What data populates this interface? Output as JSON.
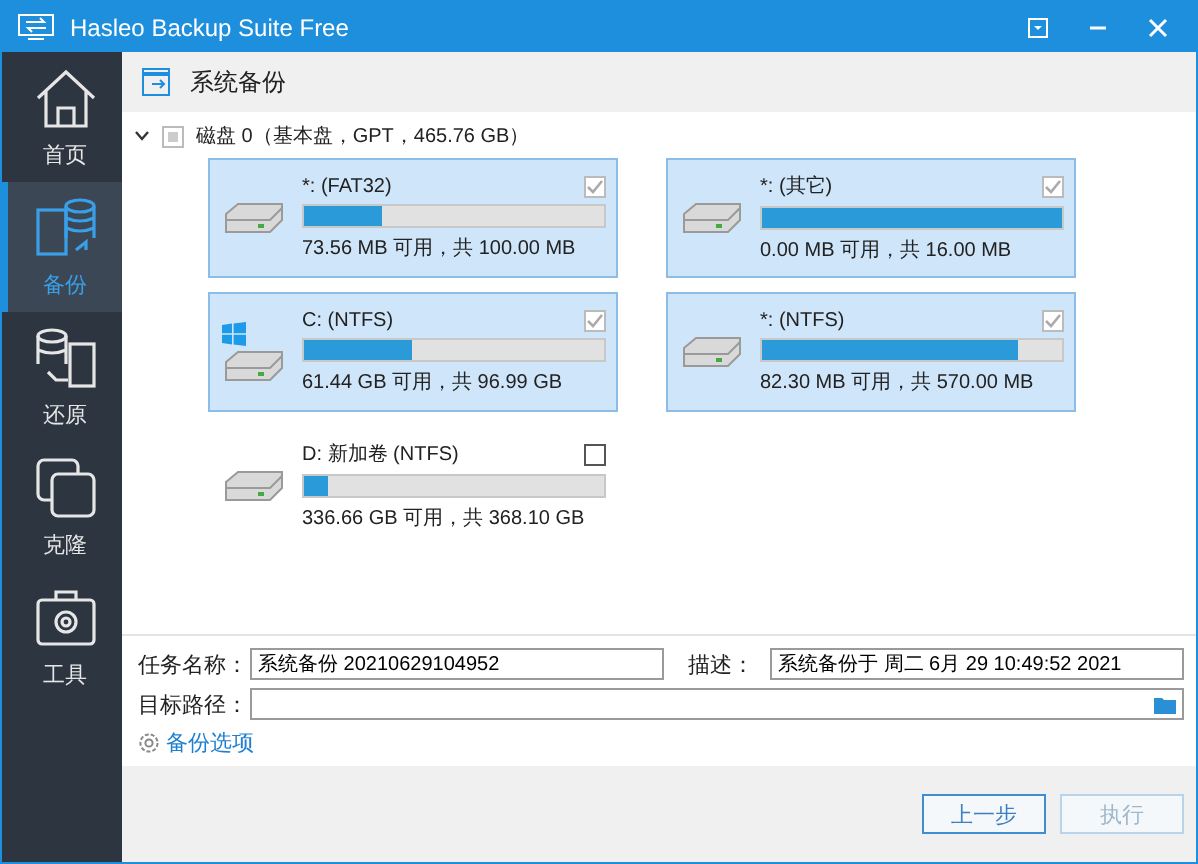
{
  "window": {
    "title": "Hasleo Backup Suite Free"
  },
  "sidebar": {
    "items": [
      {
        "label": "首页",
        "selected": false
      },
      {
        "label": "备份",
        "selected": true
      },
      {
        "label": "还原",
        "selected": false
      },
      {
        "label": "克隆",
        "selected": false
      },
      {
        "label": "工具",
        "selected": false
      }
    ]
  },
  "page_title": "系统备份",
  "disk": {
    "label": "磁盘 0（基本盘，GPT，465.76 GB）",
    "expanded": true,
    "checked": false,
    "partitions": [
      {
        "name": "*: (FAT32)",
        "level": 0.26,
        "reading": "73.56 MB 可用，共 100.00 MB",
        "checked": true,
        "windows_logo": false
      },
      {
        "name": "*: (其它)",
        "level": 1.0,
        "reading": "0.00 MB 可用，共 16.00 MB",
        "checked": true,
        "windows_logo": false
      },
      {
        "name": "C: (NTFS)",
        "level": 0.36,
        "reading": "61.44 GB 可用，共 96.99 GB",
        "checked": true,
        "windows_logo": true
      },
      {
        "name": "*: (NTFS)",
        "level": 0.85,
        "reading": "82.30 MB 可用，共 570.00 MB",
        "checked": true,
        "windows_logo": false
      },
      {
        "name": "D: 新加卷 (NTFS)",
        "level": 0.08,
        "reading": "336.66 GB 可用，共 368.10 GB",
        "checked": false,
        "windows_logo": false
      }
    ]
  },
  "form": {
    "task_name_label": "任务名称：",
    "task_name": "系统备份 20210629104952",
    "description_label": "描述：",
    "description": "系统备份于 周二 6月 29 10:49:52 2021",
    "target_label": "目标路径：",
    "options_link": "备份选项"
  },
  "buttons": [
    {
      "label": "上一步",
      "disabled": false
    },
    {
      "label": "执行",
      "disabled": true
    }
  ]
}
